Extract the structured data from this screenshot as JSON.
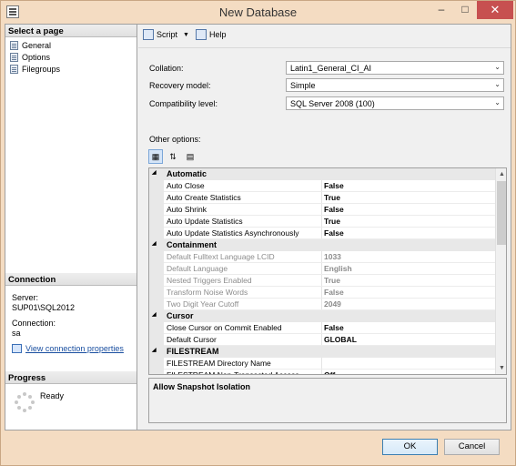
{
  "window": {
    "title": "New Database"
  },
  "left": {
    "select_page_header": "Select a page",
    "pages": [
      "General",
      "Options",
      "Filegroups"
    ],
    "connection_header": "Connection",
    "server_label": "Server:",
    "server_value": "SUP01\\SQL2012",
    "connection_label": "Connection:",
    "connection_value": "sa",
    "view_props_link": "View connection properties",
    "progress_header": "Progress",
    "progress_status": "Ready"
  },
  "toolbar": {
    "script_label": "Script",
    "help_label": "Help"
  },
  "form": {
    "collation_label": "Collation:",
    "collation_value": "Latin1_General_CI_AI",
    "recovery_label": "Recovery model:",
    "recovery_value": "Simple",
    "compat_label": "Compatibility level:",
    "compat_value": "SQL Server 2008 (100)",
    "other_options_label": "Other options:"
  },
  "grid": {
    "rows": [
      {
        "kind": "cat",
        "label": "Automatic"
      },
      {
        "kind": "prop",
        "name": "Auto Close",
        "value": "False"
      },
      {
        "kind": "prop",
        "name": "Auto Create Statistics",
        "value": "True"
      },
      {
        "kind": "prop",
        "name": "Auto Shrink",
        "value": "False"
      },
      {
        "kind": "prop",
        "name": "Auto Update Statistics",
        "value": "True"
      },
      {
        "kind": "prop",
        "name": "Auto Update Statistics Asynchronously",
        "value": "False"
      },
      {
        "kind": "cat",
        "label": "Containment"
      },
      {
        "kind": "prop",
        "name": "Default Fulltext Language LCID",
        "value": "1033",
        "disabled": true
      },
      {
        "kind": "prop",
        "name": "Default Language",
        "value": "English",
        "disabled": true
      },
      {
        "kind": "prop",
        "name": "Nested Triggers Enabled",
        "value": "True",
        "disabled": true
      },
      {
        "kind": "prop",
        "name": "Transform Noise Words",
        "value": "False",
        "disabled": true
      },
      {
        "kind": "prop",
        "name": "Two Digit Year Cutoff",
        "value": "2049",
        "disabled": true
      },
      {
        "kind": "cat",
        "label": "Cursor"
      },
      {
        "kind": "prop",
        "name": "Close Cursor on Commit Enabled",
        "value": "False"
      },
      {
        "kind": "prop",
        "name": "Default Cursor",
        "value": "GLOBAL"
      },
      {
        "kind": "cat",
        "label": "FILESTREAM"
      },
      {
        "kind": "prop",
        "name": "FILESTREAM Directory Name",
        "value": ""
      },
      {
        "kind": "prop",
        "name": "FILESTREAM Non-Transacted Access",
        "value": "Off"
      }
    ],
    "description_title": "Allow Snapshot Isolation"
  },
  "buttons": {
    "ok": "OK",
    "cancel": "Cancel"
  }
}
